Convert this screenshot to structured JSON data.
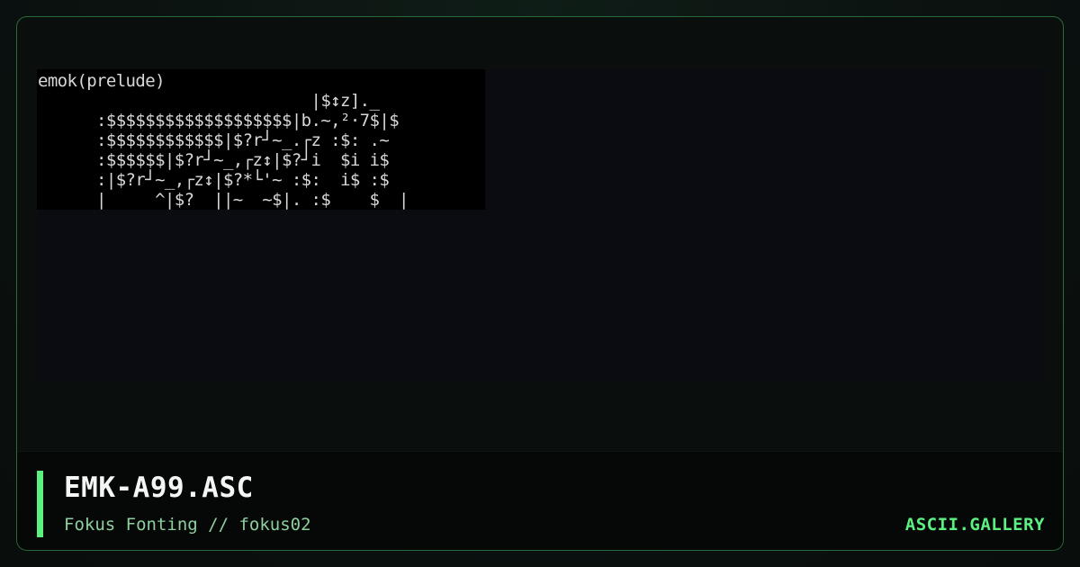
{
  "art": {
    "text": "emok(prelude)\n                            |$↕z]._\n      :$$$$$$$$$$$$$$$$$$$|b.~,²·7$|$\n      :$$$$$$$$$$$$|$?r┘~_.┌z :$: .~\n      :$$$$$$|$?r┘~_,┌z↕|$?┘i  $i i$\n      :|$?r┘~_,┌z↕|$?*└'~ :$:  i$ :$\n      |     ^|$?  ||~  ~$|. :$    $  |"
  },
  "footer": {
    "title": "EMK-A99.ASC",
    "subtitle": "Fokus Fonting // fokus02",
    "brand": "ASCII.GALLERY"
  },
  "colors": {
    "accent": "#5cf081",
    "frame_border": "#2a6a3a",
    "subtitle": "#8fcf9f"
  }
}
